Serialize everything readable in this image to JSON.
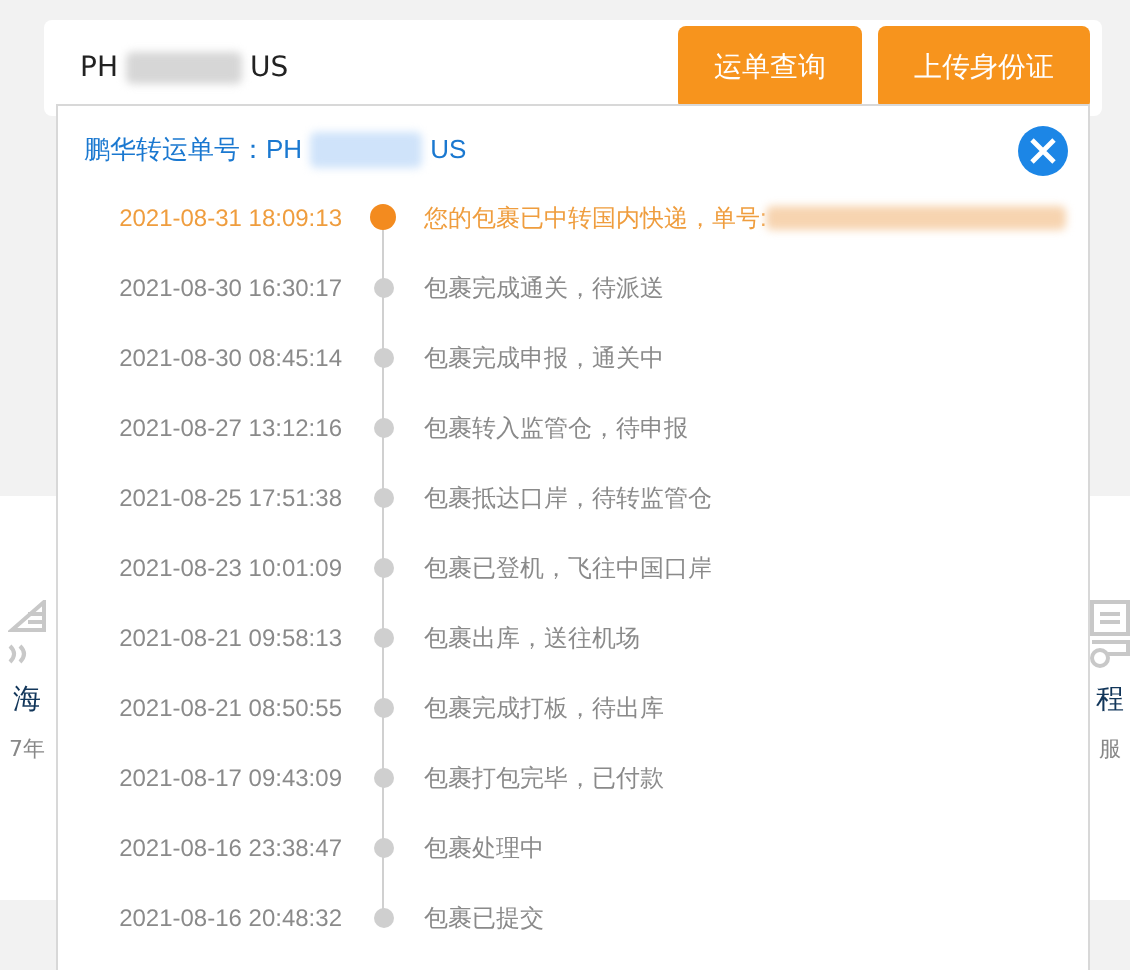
{
  "search": {
    "value_start": "PH",
    "value_end": "US"
  },
  "buttons": [
    {
      "label": "运单查询"
    },
    {
      "label": "上传身份证"
    }
  ],
  "features": [
    {
      "title": "海",
      "subtitle": "7年"
    },
    {
      "title": "程",
      "subtitle": "服"
    }
  ],
  "tracking": {
    "label": "鹏华转运单号：",
    "number_start": "PH",
    "number_end": "US",
    "events": [
      {
        "time": "2021-08-31 18:09:13",
        "text": "您的包裹已中转国内快递，单号:",
        "selected": true,
        "redacted_suffix": true
      },
      {
        "time": "2021-08-30 16:30:17",
        "text": "包裹完成通关，待派送",
        "selected": false,
        "redacted_suffix": false
      },
      {
        "time": "2021-08-30 08:45:14",
        "text": "包裹完成申报，通关中",
        "selected": false,
        "redacted_suffix": false
      },
      {
        "time": "2021-08-27 13:12:16",
        "text": "包裹转入监管仓，待申报",
        "selected": false,
        "redacted_suffix": false
      },
      {
        "time": "2021-08-25 17:51:38",
        "text": "包裹抵达口岸，待转监管仓",
        "selected": false,
        "redacted_suffix": false
      },
      {
        "time": "2021-08-23 10:01:09",
        "text": "包裹已登机，飞往中国口岸",
        "selected": false,
        "redacted_suffix": false
      },
      {
        "time": "2021-08-21 09:58:13",
        "text": "包裹出库，送往机场",
        "selected": false,
        "redacted_suffix": false
      },
      {
        "time": "2021-08-21 08:50:55",
        "text": "包裹完成打板，待出库",
        "selected": false,
        "redacted_suffix": false
      },
      {
        "time": "2021-08-17 09:43:09",
        "text": "包裹打包完毕，已付款",
        "selected": false,
        "redacted_suffix": false
      },
      {
        "time": "2021-08-16 23:38:47",
        "text": "包裹处理中",
        "selected": false,
        "redacted_suffix": false
      },
      {
        "time": "2021-08-16 20:48:32",
        "text": "包裹已提交",
        "selected": false,
        "redacted_suffix": false
      }
    ]
  }
}
